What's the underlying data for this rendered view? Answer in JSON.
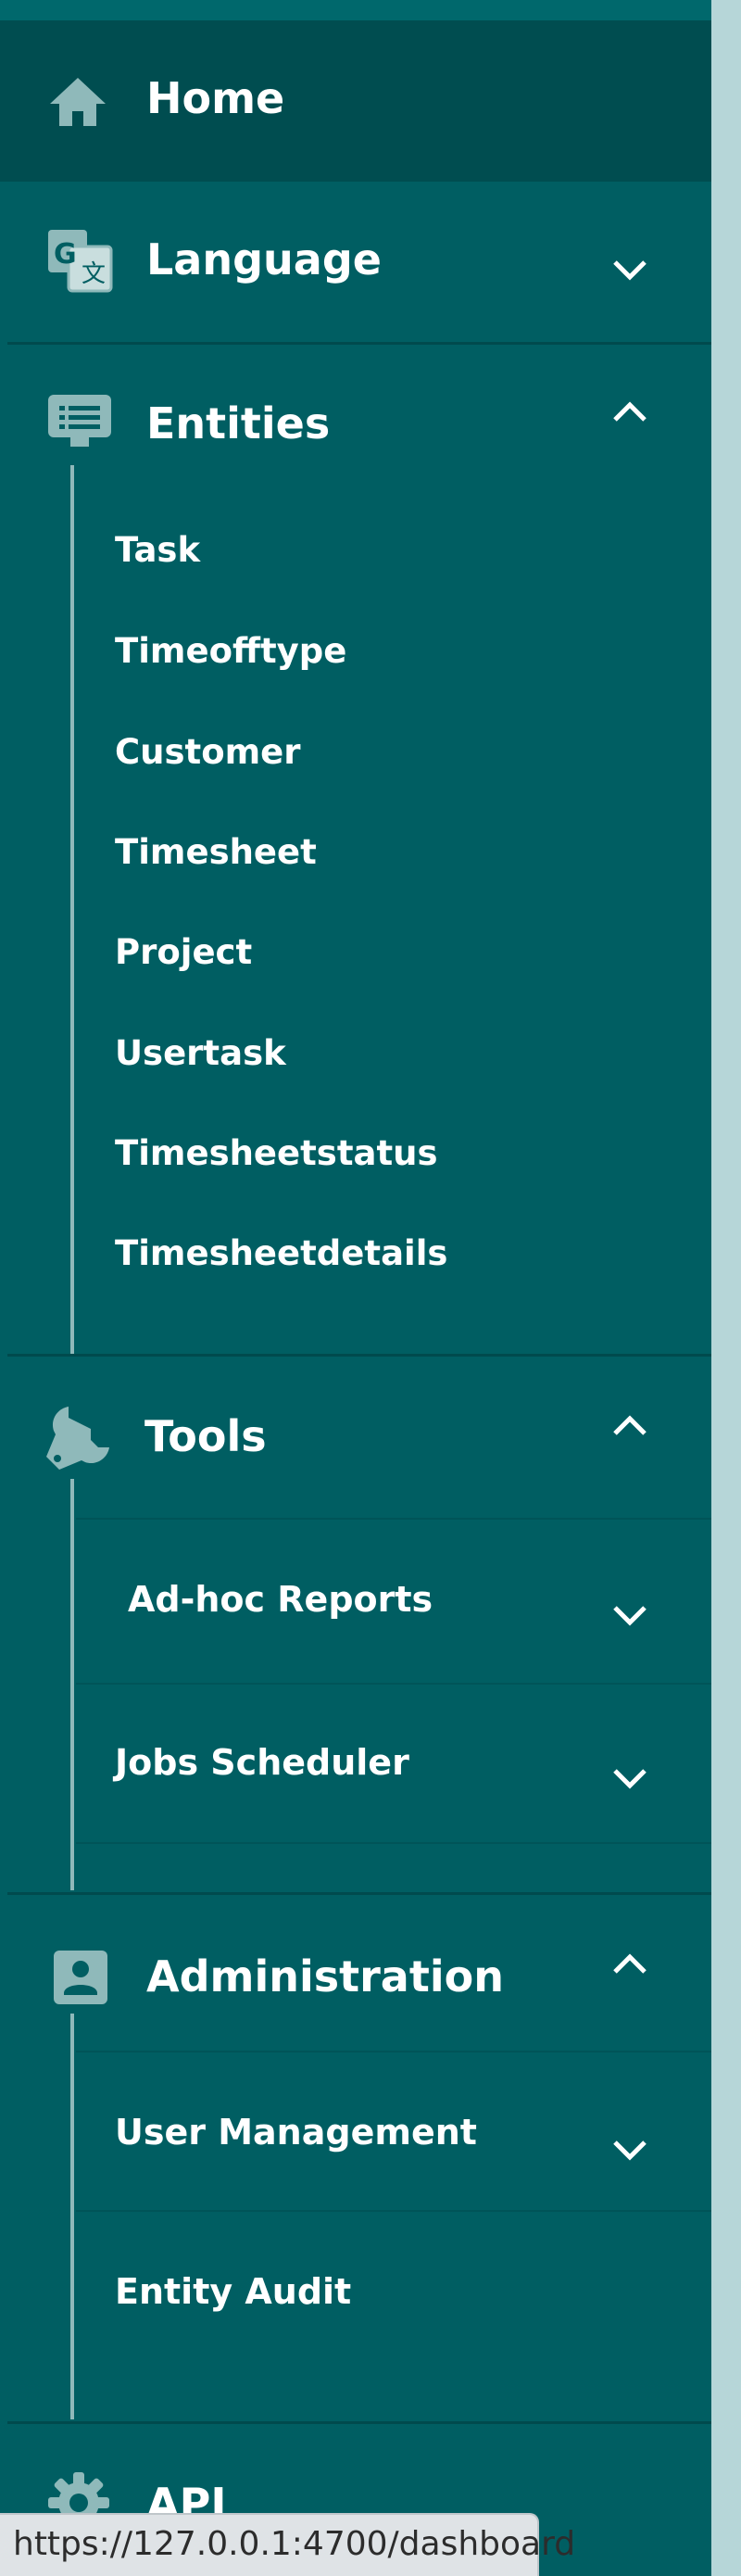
{
  "sidebar": {
    "home": {
      "label": "Home",
      "icon": "home-icon"
    },
    "language": {
      "label": "Language",
      "icon": "translate-icon",
      "expanded": false
    },
    "entities": {
      "label": "Entities",
      "icon": "list-icon",
      "expanded": true,
      "items": [
        "Task",
        "Timeofftype",
        "Customer",
        "Timesheet",
        "Project",
        "Usertask",
        "Timesheetstatus",
        "Timesheetdetails"
      ]
    },
    "tools": {
      "label": "Tools",
      "icon": "wrench-icon",
      "expanded": true,
      "children": [
        {
          "label": "Ad-hoc Reports",
          "expanded": false
        },
        {
          "label": "Jobs Scheduler",
          "expanded": false
        }
      ]
    },
    "administration": {
      "label": "Administration",
      "icon": "account-box-icon",
      "expanded": true,
      "children": [
        {
          "label": "User Management",
          "expanded": false
        },
        {
          "label": "Entity Audit"
        }
      ]
    },
    "api": {
      "label": "API",
      "icon": "gear-icon"
    }
  },
  "status_bar": {
    "url": "https://127.0.0.1:4700/dashboard"
  },
  "colors": {
    "sidebar_bg": "#005e62",
    "active_bg": "#004d50",
    "page_bg": "#b6d6d8",
    "icon": "#8fb9ba",
    "text": "#ffffff"
  }
}
